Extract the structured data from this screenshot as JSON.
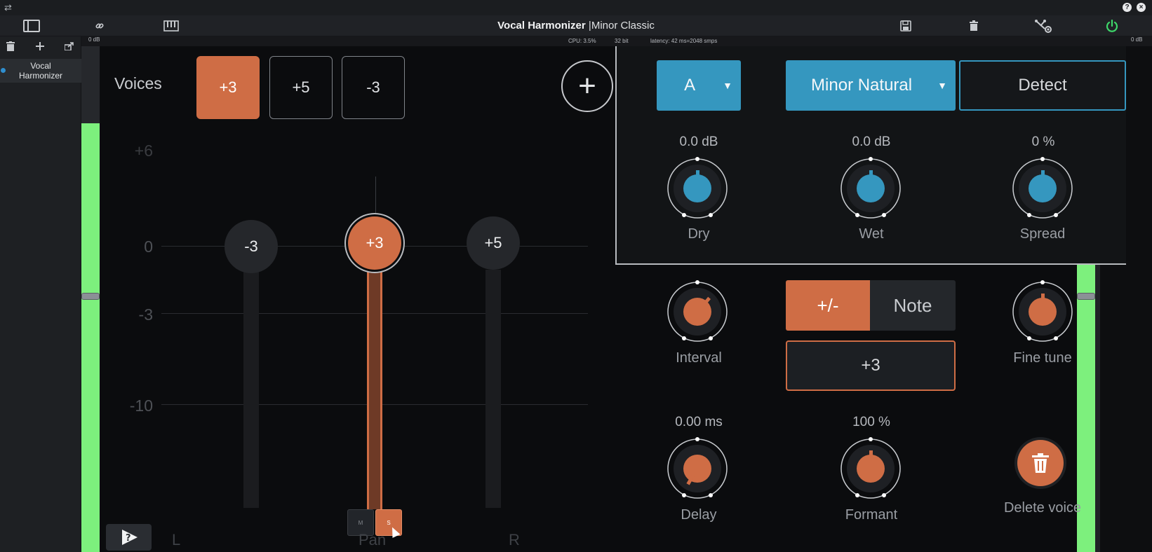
{
  "toolbar": {
    "title": "Vocal Harmonizer",
    "separator": "|",
    "preset": "Minor Classic",
    "icons": [
      "sidebar-icon",
      "link-icon",
      "piano-icon",
      "save-icon",
      "trash-icon",
      "routing-icon",
      "power-icon"
    ]
  },
  "top_strip": {
    "left_icon": "⇄",
    "help": "?",
    "close": "×"
  },
  "status": {
    "cpu": "CPU: 3.5%",
    "bits": "32 bit",
    "latency": "latency: 42 ms=2048 smps",
    "db_left": "0 dB",
    "db_right": "0 dB"
  },
  "sidebar": {
    "item_label": "Vocal Harmonizer",
    "selected": true
  },
  "voices": {
    "label": "Voices",
    "buttons": [
      {
        "label": "+3",
        "active": true
      },
      {
        "label": "+5",
        "active": false
      },
      {
        "label": "-3",
        "active": false
      }
    ],
    "add": "+"
  },
  "grid": {
    "labels": [
      "+6",
      "0",
      "-3",
      "-10"
    ]
  },
  "faders": [
    {
      "label": "-3",
      "active": false
    },
    {
      "label": "+3",
      "active": true
    },
    {
      "label": "+5",
      "active": false
    }
  ],
  "mute_solo": {
    "mute": "M",
    "solo": "S"
  },
  "pan": {
    "left": "L",
    "center": "Pan",
    "right": "R"
  },
  "key": {
    "root": "A",
    "scale": "Minor Natural",
    "detect": "Detect"
  },
  "knobs": {
    "dry": {
      "value": "0.0 dB",
      "label": "Dry"
    },
    "wet": {
      "value": "0.0 dB",
      "label": "Wet"
    },
    "spread": {
      "value": "0 %",
      "label": "Spread"
    },
    "interval": {
      "label": "Interval"
    },
    "fine_tune": {
      "label": "Fine tune"
    },
    "delay": {
      "value": "0.00 ms",
      "label": "Delay"
    },
    "formant": {
      "value": "100 %",
      "label": "Formant"
    }
  },
  "interval_mode": {
    "relative": "+/-",
    "note": "Note",
    "value": "+3"
  },
  "delete_voice": "Delete voice",
  "colors": {
    "accent_orange": "#cf6d45",
    "accent_blue": "#3597bf",
    "meter_green": "#7df07d",
    "power_green": "#3ed76a"
  }
}
